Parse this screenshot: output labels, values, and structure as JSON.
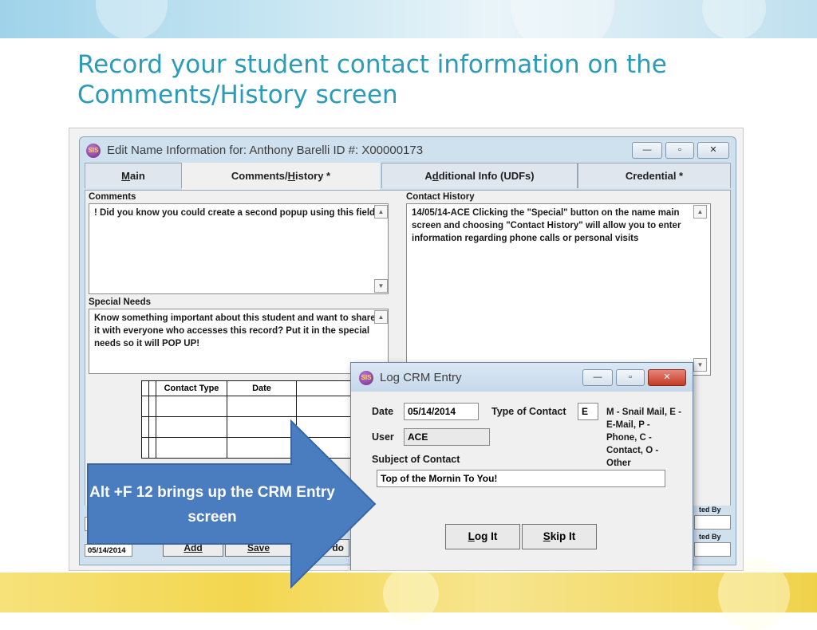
{
  "slide": {
    "title": "Record your student contact information on the Comments/History screen"
  },
  "main_window": {
    "title": "Edit Name Information for: Anthony Barelli ID #: X00000173",
    "controls": {
      "minimize": "—",
      "maximize": "▫",
      "close": "✕"
    },
    "tabs": [
      {
        "prefix": "",
        "accel": "M",
        "rest": "ain"
      },
      {
        "prefix": "Comments/",
        "accel": "H",
        "rest": "istory *"
      },
      {
        "prefix": "A",
        "accel": "d",
        "rest": "ditional Info (UDFs)"
      },
      {
        "prefix": "Credential *",
        "accel": "",
        "rest": ""
      }
    ],
    "comments_label": "Comments",
    "comments_text": "! Did you know you could create a second popup using this field?",
    "special_needs_label": "Special Needs",
    "special_needs_text": "Know something important about this student and want to share it with everyone who accesses this record? Put it in the special needs so it will POP UP!",
    "contact_history_label": "Contact History",
    "contact_history_text": "14/05/14-ACE    Clicking the \"Special\" button on the name main screen and choosing \"Contact History\" will allow you to enter information regarding phone calls or personal visits",
    "grid_headers": [
      "Contact Type",
      "Date"
    ],
    "bottom_date": "05/14/2014",
    "bottom_buttons": [
      "Add",
      "Save",
      "do"
    ],
    "right_labels": [
      "ted By",
      "ted By"
    ]
  },
  "crm_dialog": {
    "title": "Log CRM Entry",
    "date_label": "Date",
    "date_value": "05/14/2014",
    "type_label": "Type of Contact",
    "type_value": "E",
    "type_legend": "M - Snail Mail, E - E-Mail,    P - Phone,    C - Contact,  O - Other",
    "user_label": "User",
    "user_value": "ACE",
    "subject_label": "Subject of Contact",
    "subject_value": "Top of the Mornin To You!",
    "log_button": {
      "accel": "L",
      "rest": "og It"
    },
    "skip_button": {
      "accel": "S",
      "rest": "kip It"
    }
  },
  "callout": {
    "text": "Alt +F 12 brings up  the CRM Entry screen",
    "color": "#4a7dbf"
  }
}
